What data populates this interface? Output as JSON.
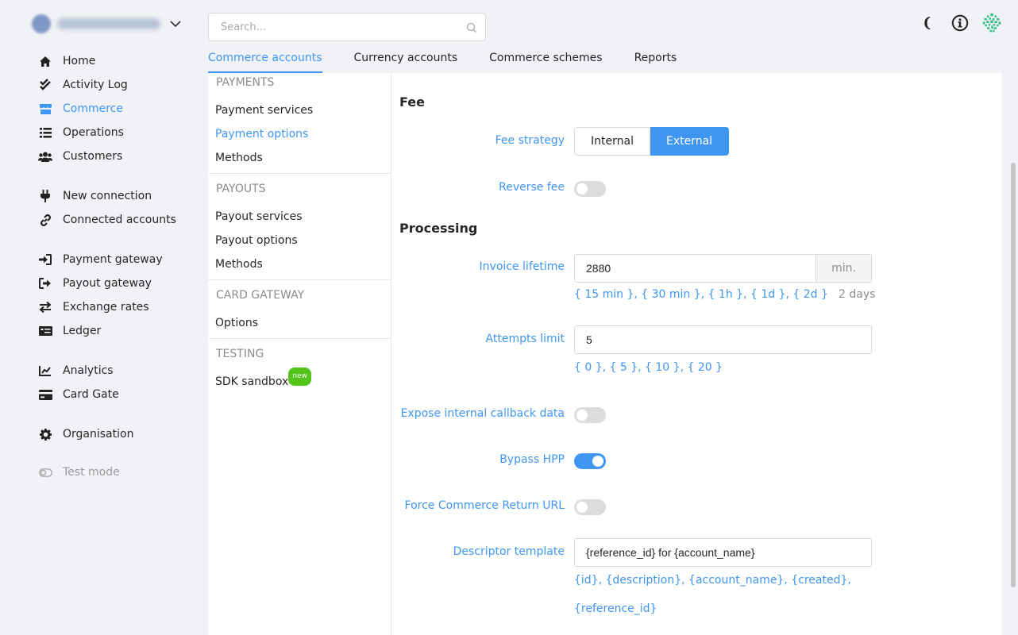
{
  "account": {
    "name": "DEMO ACCOUNT"
  },
  "sidebar": {
    "items": [
      {
        "label": "Home",
        "icon": "home-icon"
      },
      {
        "label": "Activity Log",
        "icon": "double-check-icon"
      },
      {
        "label": "Commerce",
        "icon": "store-icon",
        "active": true
      },
      {
        "label": "Operations",
        "icon": "list-icon"
      },
      {
        "label": "Customers",
        "icon": "users-icon"
      },
      {
        "label": "New connection",
        "icon": "plug-icon"
      },
      {
        "label": "Connected accounts",
        "icon": "link-icon"
      },
      {
        "label": "Payment gateway",
        "icon": "sign-in-icon"
      },
      {
        "label": "Payout gateway",
        "icon": "sign-out-icon"
      },
      {
        "label": "Exchange rates",
        "icon": "exchange-icon"
      },
      {
        "label": "Ledger",
        "icon": "money-bill-icon"
      },
      {
        "label": "Analytics",
        "icon": "chart-line-icon"
      },
      {
        "label": "Card Gate",
        "icon": "credit-card-icon"
      },
      {
        "label": "Organisation",
        "icon": "gear-icon"
      },
      {
        "label": "Test mode",
        "icon": "toggle-off-icon"
      }
    ]
  },
  "search": {
    "placeholder": "Search..."
  },
  "tabs": [
    {
      "label": "Commerce accounts",
      "active": true
    },
    {
      "label": "Currency accounts"
    },
    {
      "label": "Commerce schemes"
    },
    {
      "label": "Reports"
    }
  ],
  "submenu": {
    "payments": {
      "title": "PAYMENTS",
      "items": [
        "Payment services",
        "Payment options",
        "Methods"
      ]
    },
    "payouts": {
      "title": "PAYOUTS",
      "items": [
        "Payout services",
        "Payout options",
        "Methods"
      ]
    },
    "card_gateway": {
      "title": "CARD GATEWAY",
      "items": [
        "Options"
      ]
    },
    "testing": {
      "title": "TESTING",
      "items": [
        "SDK sandbox"
      ],
      "badge": "new"
    }
  },
  "fee": {
    "title": "Fee",
    "strategy_label": "Fee strategy",
    "strategy_options": [
      "Internal",
      "External"
    ],
    "strategy_selected": "External",
    "reverse_label": "Reverse fee",
    "reverse_on": false
  },
  "processing": {
    "title": "Processing",
    "invoice_label": "Invoice lifetime",
    "invoice_value": "2880",
    "invoice_unit": "min.",
    "invoice_hints": "{ 15 min }, { 30 min }, { 1h }, { 1d }, { 2d }",
    "invoice_human": "2 days",
    "attempts_label": "Attempts limit",
    "attempts_value": "5",
    "attempts_hints": "{ 0 }, { 5 }, { 10 }, { 20 }",
    "expose_label": "Expose internal callback data",
    "expose_on": false,
    "bypass_label": "Bypass HPP",
    "bypass_on": true,
    "force_label": "Force Commerce Return URL",
    "force_on": false,
    "descriptor_label": "Descriptor template",
    "descriptor_value": "{reference_id} for {account_name}",
    "descriptor_hints_line1": "{id}, {description}, {account_name}, {created},",
    "descriptor_hints_line2": "{reference_id}"
  },
  "colors": {
    "accent": "#3f96f2",
    "badge": "#52c41a",
    "background": "#f0f2f5"
  }
}
